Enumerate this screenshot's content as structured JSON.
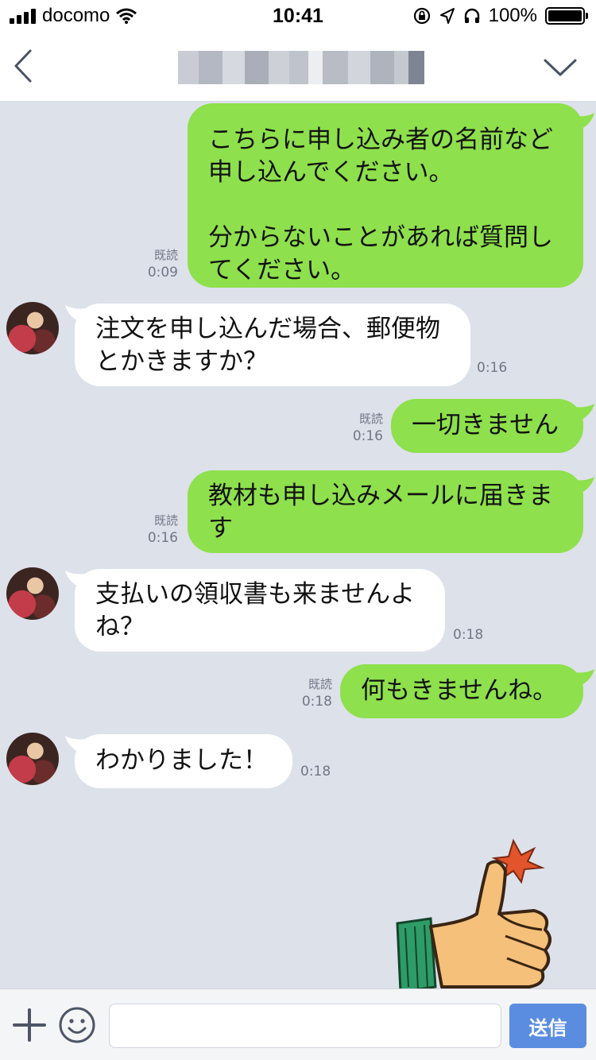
{
  "status_bar": {
    "carrier": "docomo",
    "time": "10:41",
    "battery_percent": "100%",
    "battery_level": 1.0,
    "icons": [
      "signal-icon",
      "wifi-icon",
      "rotation-lock-icon",
      "location-icon",
      "headphones-icon",
      "battery-icon"
    ]
  },
  "nav": {
    "back_icon": "chevron-left-icon",
    "title_redacted": true,
    "menu_icon": "chevron-down-icon"
  },
  "messages": [
    {
      "sender": "me",
      "text": "こちらに申し込み者の名前など\n申し込んでください。\n\n分からないことがあれば質問し\nてください。",
      "read": "既読",
      "time": "0:09"
    },
    {
      "sender": "other",
      "text": "注文を申し込んだ場合、郵便物\nとかきますか？",
      "time": "0:16"
    },
    {
      "sender": "me",
      "text": "一切きません",
      "read": "既読",
      "time": "0:16"
    },
    {
      "sender": "me",
      "text": "教材も申し込みメールに届きま\nす",
      "read": "既読",
      "time": "0:16"
    },
    {
      "sender": "other",
      "text": "支払いの領収書も来ませんよ\nね？",
      "time": "0:18"
    },
    {
      "sender": "me",
      "text": "何もきませんね。",
      "read": "既読",
      "time": "0:18"
    },
    {
      "sender": "other",
      "text": "わかりました！",
      "time": "0:18"
    }
  ],
  "sticker": {
    "name": "thumbs-up-sticker"
  },
  "input_bar": {
    "plus_icon": "plus-icon",
    "emoji_icon": "smiley-icon",
    "input_value": "",
    "send_label": "送信"
  },
  "colors": {
    "chat_background": "#dde1ea",
    "my_bubble": "#8ee04c",
    "their_bubble": "#ffffff",
    "send_button": "#5a8de0",
    "meta_text": "#707785"
  }
}
